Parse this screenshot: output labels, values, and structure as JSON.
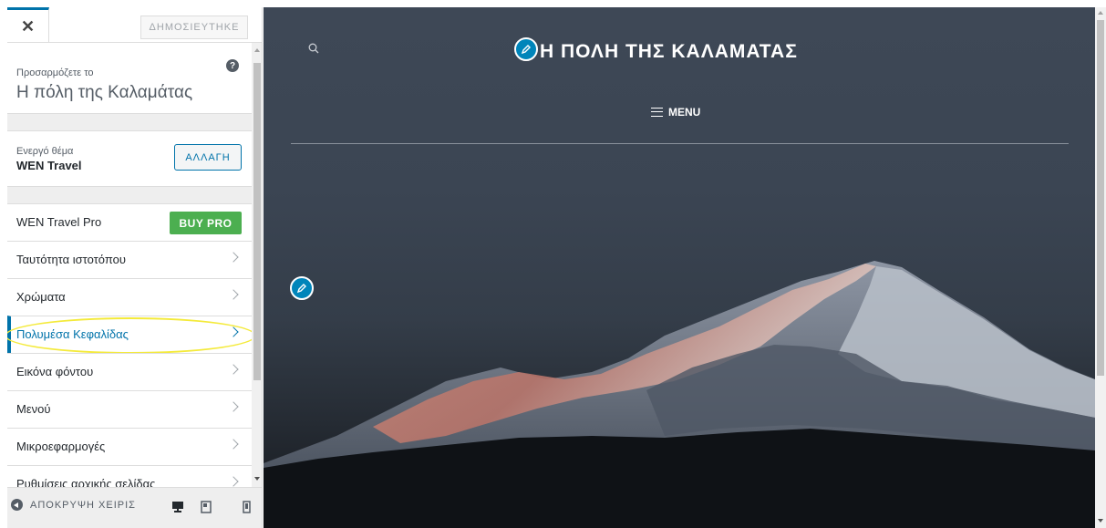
{
  "header": {
    "close_icon": "close-icon",
    "publish_label": "ΔΗΜΟΣΙΕΥΤΗΚΕ"
  },
  "info": {
    "pre_title": "Προσαρμόζετε το",
    "title": "Η πόλη της Καλαμάτας",
    "help_icon": "help-icon"
  },
  "theme": {
    "pre_title": "Ενεργό θέμα",
    "name": "WEN Travel",
    "change_label": "ΑΛΛΑΓΗ"
  },
  "menu": {
    "items": [
      {
        "label": "WEN Travel Pro",
        "button": "BUY PRO"
      },
      {
        "label": "Ταυτότητα ιστοτόπου"
      },
      {
        "label": "Χρώματα"
      },
      {
        "label": "Πολυμέσα Κεφαλίδας",
        "active": true,
        "highlighted": true
      },
      {
        "label": "Εικόνα φόντου"
      },
      {
        "label": "Μενού"
      },
      {
        "label": "Μικροεφαρμογές"
      },
      {
        "label": "Ρυθμίσεις αρχικής σελίδας"
      }
    ]
  },
  "footer": {
    "collapse_label": "ΑΠΟΚΡΥΨΗ ΧΕΙΡΙΣ",
    "devices": [
      "desktop-icon",
      "tablet-icon",
      "mobile-icon"
    ]
  },
  "preview": {
    "site_title": "Η ΠΟΛΗ ΤΗΣ ΚΑΛΑΜΑΤΑΣ",
    "menu_label": "MENU",
    "search_icon": "search-icon",
    "edit_icon": "pencil-icon"
  },
  "colors": {
    "accent": "#0073aa",
    "buy_pro": "#4caf50",
    "edit_shortcut": "#0085ba",
    "highlight": "#f4ea3a",
    "preview_bg": "#3b4553"
  }
}
